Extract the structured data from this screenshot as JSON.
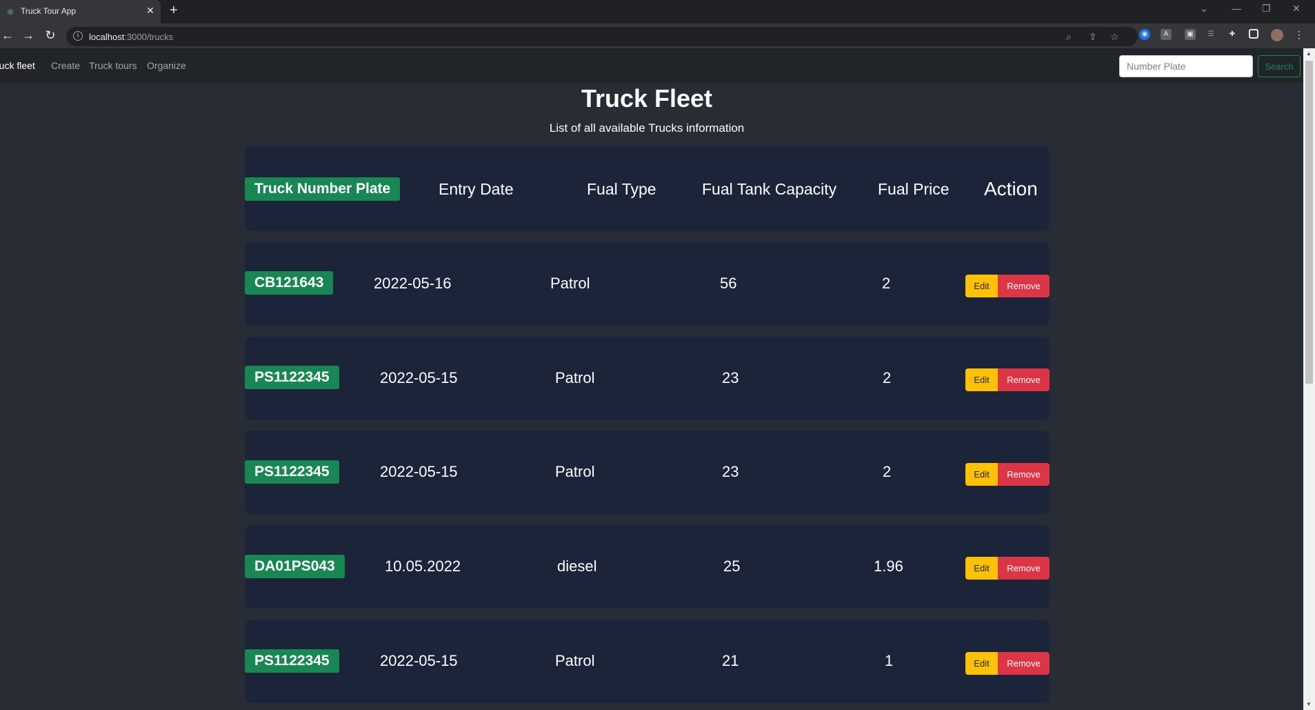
{
  "browser": {
    "tab_title": "Truck Tour App",
    "url_host": "localhost",
    "url_path": ":3000/trucks"
  },
  "nav": {
    "brand": "ruck fleet",
    "links": [
      "Create",
      "Truck tours",
      "Organize"
    ],
    "search_placeholder": "Number Plate",
    "search_button": "Search"
  },
  "page": {
    "title": "Truck Fleet",
    "subtitle": "List of all available Trucks information"
  },
  "table": {
    "headers": {
      "plate": "Truck Number Plate",
      "entry_date": "Entry Date",
      "fuel_type": "Fual Type",
      "tank_capacity": "Fual Tank Capacity",
      "fuel_price": "Fual Price",
      "action": "Action"
    },
    "edit_label": "Edit",
    "remove_label": "Remove",
    "rows": [
      {
        "plate": "CB121643",
        "entry_date": "2022-05-16",
        "fuel_type": "Patrol",
        "tank_capacity": "56",
        "fuel_price": "2"
      },
      {
        "plate": "PS1122345",
        "entry_date": "2022-05-15",
        "fuel_type": "Patrol",
        "tank_capacity": "23",
        "fuel_price": "2"
      },
      {
        "plate": "PS1122345",
        "entry_date": "2022-05-15",
        "fuel_type": "Patrol",
        "tank_capacity": "23",
        "fuel_price": "2"
      },
      {
        "plate": "DA01PS043",
        "entry_date": "10.05.2022",
        "fuel_type": "diesel",
        "tank_capacity": "25",
        "fuel_price": "1.96"
      },
      {
        "plate": "PS1122345",
        "entry_date": "2022-05-15",
        "fuel_type": "Patrol",
        "tank_capacity": "21",
        "fuel_price": "1"
      }
    ]
  },
  "colors": {
    "page_bg": "#282c34",
    "card_bg": "#1b2438",
    "plate_badge": "#198754",
    "edit_button": "#ffc107",
    "remove_button": "#dc3545"
  }
}
